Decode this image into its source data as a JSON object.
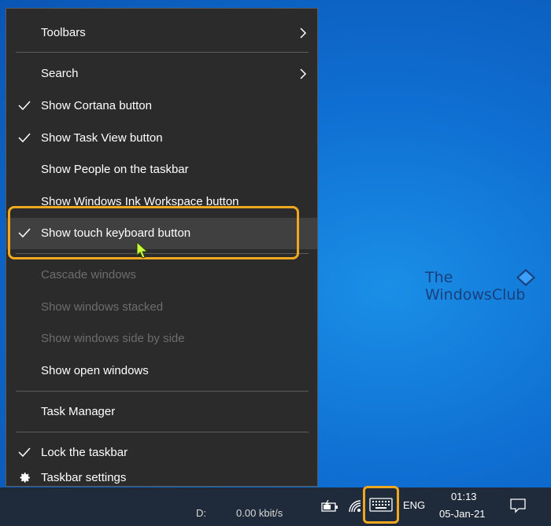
{
  "menu": {
    "items": [
      {
        "label": "Toolbars",
        "checked": false,
        "submenu": true,
        "disabled": false
      },
      {
        "label": "Search",
        "checked": false,
        "submenu": true,
        "disabled": false
      },
      {
        "label": "Show Cortana button",
        "checked": true,
        "submenu": false,
        "disabled": false
      },
      {
        "label": "Show Task View button",
        "checked": true,
        "submenu": false,
        "disabled": false
      },
      {
        "label": "Show People on the taskbar",
        "checked": false,
        "submenu": false,
        "disabled": false
      },
      {
        "label": "Show Windows Ink Workspace button",
        "checked": false,
        "submenu": false,
        "disabled": false
      },
      {
        "label": "Show touch keyboard button",
        "checked": true,
        "submenu": false,
        "disabled": false,
        "hovered": true
      },
      {
        "label": "Cascade windows",
        "checked": false,
        "submenu": false,
        "disabled": true
      },
      {
        "label": "Show windows stacked",
        "checked": false,
        "submenu": false,
        "disabled": true
      },
      {
        "label": "Show windows side by side",
        "checked": false,
        "submenu": false,
        "disabled": true
      },
      {
        "label": "Show open windows",
        "checked": false,
        "submenu": false,
        "disabled": false
      },
      {
        "label": "Task Manager",
        "checked": false,
        "submenu": false,
        "disabled": false
      },
      {
        "label": "Lock the taskbar",
        "checked": true,
        "submenu": false,
        "disabled": false
      },
      {
        "label": "Taskbar settings",
        "icon": "gear-icon",
        "checked": false,
        "submenu": false,
        "disabled": false
      }
    ]
  },
  "watermark": {
    "line1": "The",
    "line2": "WindowsClub"
  },
  "taskbar": {
    "network_label": "D:",
    "network_speed": "0.00 kbit/s",
    "language": "ENG",
    "time": "01:13",
    "date": "05-Jan-21",
    "icons": [
      "battery-icon",
      "wifi-icon",
      "touch-keyboard-icon",
      "notification-icon"
    ]
  },
  "colors": {
    "highlight": "#f0a820",
    "menu_bg": "#2b2b2b",
    "taskbar_bg": "#1f2b3a",
    "desktop_blue": "#0f6fd2"
  }
}
